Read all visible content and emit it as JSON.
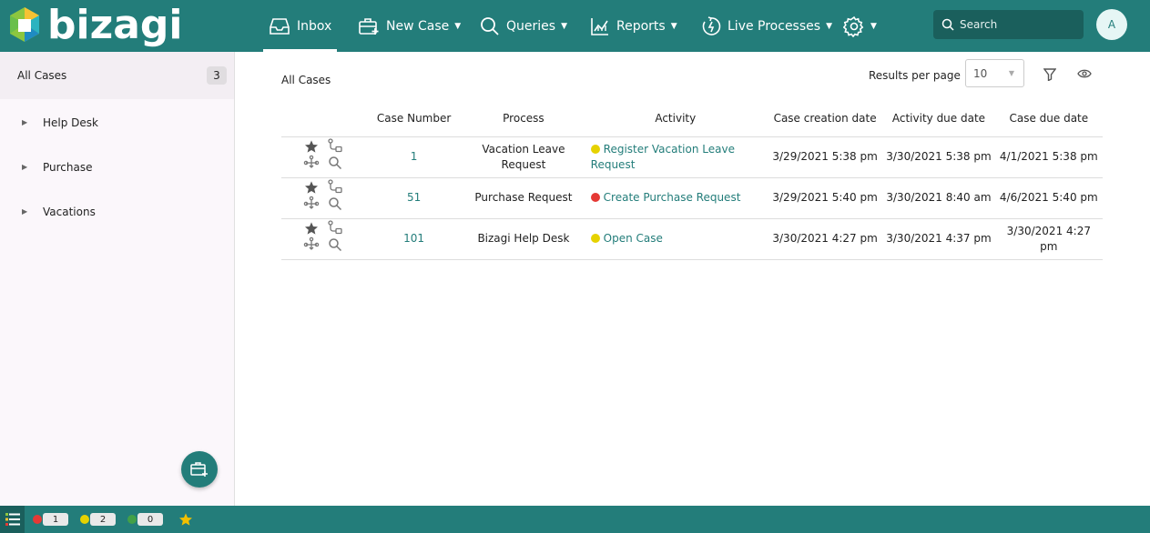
{
  "brand": {
    "name": "bizagi"
  },
  "nav": {
    "inbox": "Inbox",
    "new_case": "New Case",
    "queries": "Queries",
    "reports": "Reports",
    "live_processes": "Live Processes"
  },
  "search": {
    "placeholder": "Search"
  },
  "user": {
    "initial": "A"
  },
  "sidebar": {
    "all_cases": {
      "label": "All Cases",
      "count": "3"
    },
    "items": [
      {
        "label": "Help Desk"
      },
      {
        "label": "Purchase"
      },
      {
        "label": "Vacations"
      }
    ]
  },
  "main": {
    "title": "All Cases",
    "results_per_page_label": "Results per page",
    "results_per_page_value": "10"
  },
  "table": {
    "headers": {
      "case_number": "Case Number",
      "process": "Process",
      "activity": "Activity",
      "creation_date": "Case creation date",
      "activity_due": "Activity due date",
      "case_due": "Case due date"
    },
    "rows": [
      {
        "case_number": "1",
        "process": "Vacation Leave Request",
        "activity": "Register Vacation Leave Request",
        "status": "yellow",
        "creation_date": "3/29/2021 5:38 pm",
        "activity_due": "3/30/2021 5:38 pm",
        "case_due": "4/1/2021 5:38 pm"
      },
      {
        "case_number": "51",
        "process": "Purchase Request",
        "activity": "Create Purchase Request",
        "status": "red",
        "creation_date": "3/29/2021 5:40 pm",
        "activity_due": "3/30/2021 8:40 am",
        "case_due": "4/6/2021 5:40 pm"
      },
      {
        "case_number": "101",
        "process": "Bizagi Help Desk",
        "activity": "Open Case",
        "status": "yellow",
        "creation_date": "3/30/2021 4:27 pm",
        "activity_due": "3/30/2021 4:37 pm",
        "case_due": "3/30/2021 4:27 pm"
      }
    ]
  },
  "footer": {
    "red_count": "1",
    "yellow_count": "2",
    "green_count": "0"
  },
  "colors": {
    "brand": "#237d7a",
    "status_red": "#e53935",
    "status_yellow": "#e6d200",
    "status_green": "#43a047",
    "star": "#f2c000"
  },
  "icons": [
    "inbox-icon",
    "new-case-icon",
    "search-icon",
    "reports-icon",
    "live-processes-icon",
    "gear-icon",
    "filter-icon",
    "eye-icon",
    "star-icon",
    "workflow-icon",
    "hierarchy-icon",
    "magnifier-icon",
    "menu-icon"
  ]
}
